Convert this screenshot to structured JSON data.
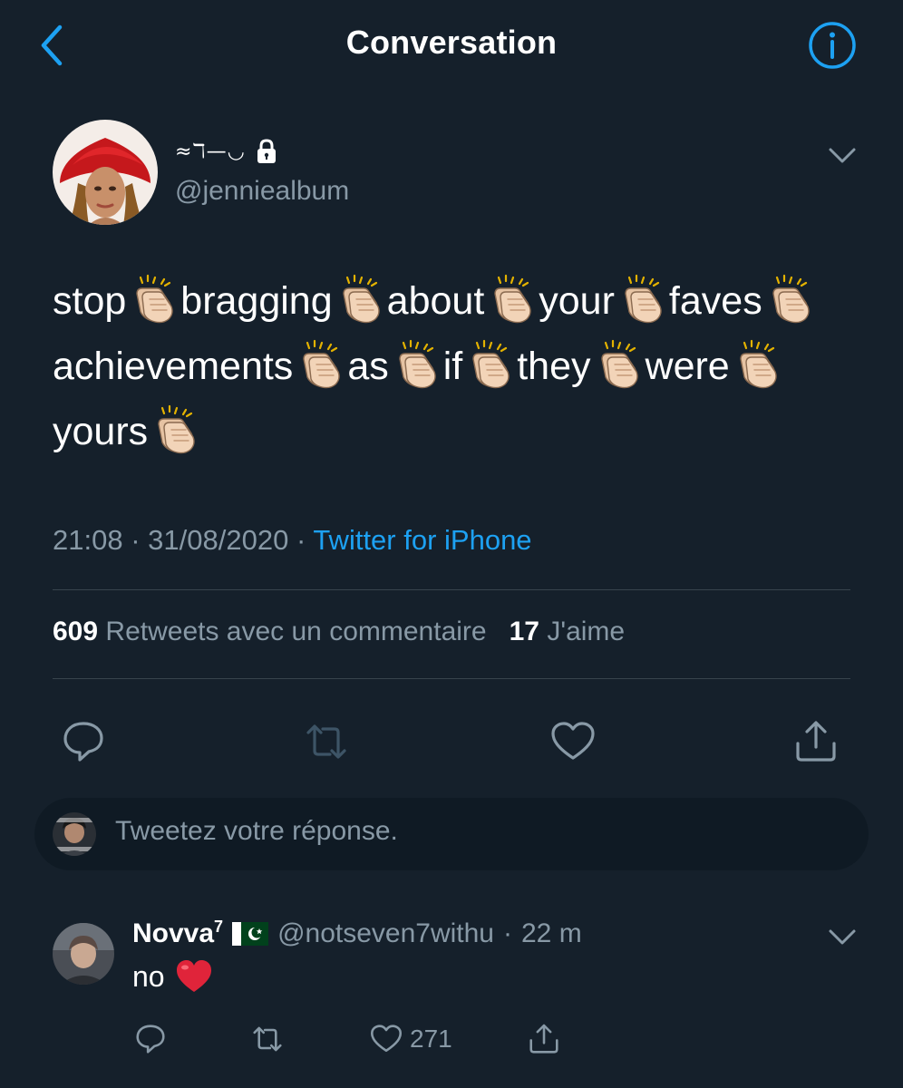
{
  "header": {
    "title": "Conversation",
    "back_icon": "chevron-left-icon",
    "info_icon": "info-icon"
  },
  "tweet": {
    "display_name_glyphs": "≈ℸ—◡",
    "handle": "@jenniealbum",
    "protected_icon": "lock-icon",
    "words": [
      "stop",
      "bragging",
      "about",
      "your",
      "faves",
      "achievements",
      "as",
      "if",
      "they",
      "were",
      "yours"
    ],
    "emoji": "clapping-hands-icon",
    "time": "21:08",
    "date": "31/08/2020",
    "separator": "·",
    "source": "Twitter for iPhone",
    "quote_count": "609",
    "quote_label": "Retweets avec un commentaire",
    "like_count": "17",
    "like_label": "J'aime"
  },
  "composer": {
    "placeholder": "Tweetez votre réponse."
  },
  "reply": {
    "name": "Novva",
    "name_superscript": "7",
    "flag": "pakistan-flag-icon",
    "handle": "@notseven7withu",
    "separator": "·",
    "time": "22 m",
    "text": "no",
    "like_count": "271"
  },
  "colors": {
    "background": "#15202b",
    "text": "#ffffff",
    "secondary": "#8899a6",
    "accent": "#1da1f2",
    "divider": "#38444d"
  }
}
